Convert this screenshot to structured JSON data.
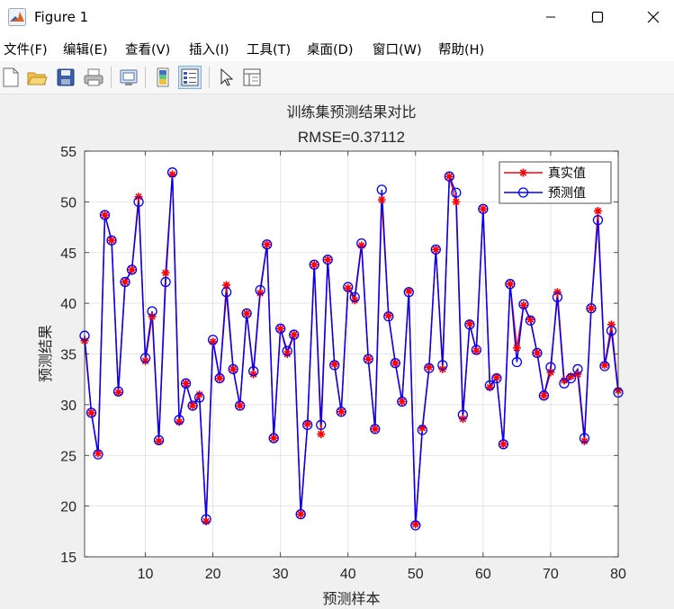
{
  "window": {
    "title": "Figure 1"
  },
  "menu": [
    "文件(F)",
    "编辑(E)",
    "查看(V)",
    "插入(I)",
    "工具(T)",
    "桌面(D)",
    "窗口(W)",
    "帮助(H)"
  ],
  "chart_data": {
    "type": "line",
    "title": "训练集预测结果对比",
    "subtitle": "RMSE=0.37112",
    "xlabel": "预测样本",
    "ylabel": "预测结果",
    "xlim": [
      1,
      80
    ],
    "ylim": [
      15,
      55
    ],
    "xticks": [
      10,
      20,
      30,
      40,
      50,
      60,
      70,
      80
    ],
    "yticks": [
      15,
      20,
      25,
      30,
      35,
      40,
      45,
      50,
      55
    ],
    "grid": true,
    "legend_position": "top-right",
    "x": [
      1,
      2,
      3,
      4,
      5,
      6,
      7,
      8,
      9,
      10,
      11,
      12,
      13,
      14,
      15,
      16,
      17,
      18,
      19,
      20,
      21,
      22,
      23,
      24,
      25,
      26,
      27,
      28,
      29,
      30,
      31,
      32,
      33,
      34,
      35,
      36,
      37,
      38,
      39,
      40,
      41,
      42,
      43,
      44,
      45,
      46,
      47,
      48,
      49,
      50,
      51,
      52,
      53,
      54,
      55,
      56,
      57,
      58,
      59,
      60,
      61,
      62,
      63,
      64,
      65,
      66,
      67,
      68,
      69,
      70,
      71,
      72,
      73,
      74,
      75,
      76,
      77,
      78,
      79,
      80
    ],
    "series": [
      {
        "name": "真实值",
        "color": "#ff0000",
        "marker": "asterisk",
        "values": [
          36.3,
          29.2,
          25.2,
          48.7,
          46.2,
          31.2,
          42.1,
          43.3,
          50.5,
          34.3,
          38.7,
          26.4,
          43.0,
          52.7,
          28.3,
          32.1,
          29.9,
          31.0,
          18.5,
          36.2,
          32.6,
          41.8,
          33.5,
          29.9,
          39.0,
          33.0,
          41.0,
          45.8,
          26.7,
          37.5,
          35.0,
          36.9,
          19.2,
          28.1,
          43.8,
          27.1,
          44.3,
          34.0,
          29.3,
          41.5,
          40.3,
          45.7,
          34.5,
          27.6,
          50.2,
          38.8,
          34.1,
          30.3,
          41.2,
          18.2,
          27.7,
          33.7,
          45.3,
          33.5,
          52.5,
          50.0,
          28.6,
          38.0,
          35.3,
          49.3,
          31.7,
          32.7,
          26.1,
          41.9,
          35.6,
          39.8,
          38.4,
          35.1,
          30.9,
          33.2,
          41.1,
          32.4,
          32.8,
          33.0,
          26.4,
          39.5,
          49.1,
          33.9,
          37.9,
          31.4
        ]
      },
      {
        "name": "预测值",
        "color": "#0000ff",
        "marker": "circle",
        "values": [
          36.8,
          29.2,
          25.1,
          48.7,
          46.2,
          31.3,
          42.1,
          43.3,
          50.0,
          34.6,
          39.2,
          26.5,
          42.1,
          52.9,
          28.5,
          32.1,
          29.9,
          30.7,
          18.7,
          36.4,
          32.6,
          41.1,
          33.5,
          29.9,
          39.0,
          33.3,
          41.3,
          45.8,
          26.7,
          37.5,
          35.3,
          36.9,
          19.2,
          28.0,
          43.8,
          28.0,
          44.3,
          33.9,
          29.3,
          41.6,
          40.6,
          45.9,
          34.5,
          27.6,
          51.2,
          38.7,
          34.1,
          30.3,
          41.1,
          18.1,
          27.5,
          33.6,
          45.3,
          33.9,
          52.5,
          50.9,
          29.0,
          37.9,
          35.4,
          49.3,
          31.9,
          32.6,
          26.1,
          41.9,
          34.2,
          39.9,
          38.3,
          35.1,
          30.9,
          33.7,
          40.6,
          32.1,
          32.6,
          33.5,
          26.7,
          39.5,
          48.2,
          33.8,
          37.3,
          31.2
        ]
      }
    ]
  }
}
